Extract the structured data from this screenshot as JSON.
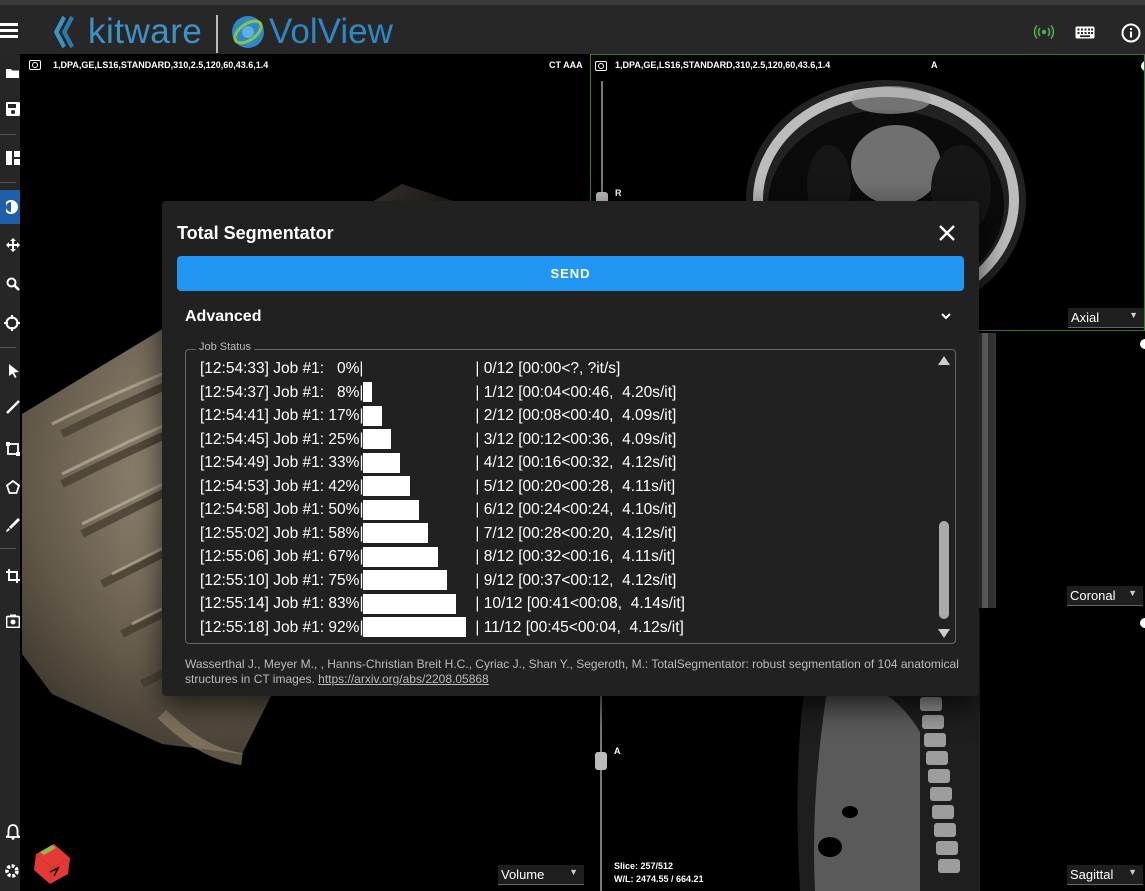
{
  "header": {
    "kitware_logo": "kitware",
    "volview_logo": "VolView",
    "icons": [
      "menu-icon",
      "server-connected-icon",
      "keyboard-icon",
      "info-icon"
    ],
    "accent_color": "#3c93c7",
    "connected_color": "#4caf50"
  },
  "sidebar": {
    "items": [
      "folder-open-icon",
      "save-icon",
      "layout-icon",
      "window-level-icon",
      "pan-icon",
      "zoom-icon",
      "crosshairs-icon",
      "select-icon",
      "ruler-icon",
      "rectangle-icon",
      "polygon-icon",
      "paint-icon",
      "crop-icon",
      "screenshot-icon",
      "notifications-icon",
      "settings-icon"
    ],
    "active_index": 3,
    "active_color": "#1f5fa8"
  },
  "views": {
    "volume": {
      "label": "1,DPA,GE,LS16,STANDARD,310,2.5,120,60,43.6,1.4",
      "series": "CT AAA",
      "type": "Volume"
    },
    "axial": {
      "label": "1,DPA,GE,LS16,STANDARD,310,2.5,120,60,43.6,1.4",
      "orientation": "A",
      "side_marker": "R",
      "type": "Axial"
    },
    "coronal": {
      "type": "Coronal"
    },
    "sagittal": {
      "type": "Sagittal",
      "orientation": "A",
      "slice": "Slice: 257/512",
      "wl": "W/L: 2474.55 / 664.21"
    }
  },
  "dialog": {
    "title": "Total Segmentator",
    "send_label": "SEND",
    "advanced_label": "Advanced",
    "job_status_label": "Job Status",
    "jobs": [
      {
        "time": "[12:54:33] Job #1:",
        "pct": "0%|",
        "fill": 0.0,
        "tail": "| 0/12 [00:00<?, ?it/s]"
      },
      {
        "time": "[12:54:37] Job #1:",
        "pct": "8%|",
        "fill": 0.08,
        "tail": "| 1/12 [00:04<00:46,  4.20s/it]"
      },
      {
        "time": "[12:54:41] Job #1:",
        "pct": "17%|",
        "fill": 0.17,
        "tail": "| 2/12 [00:08<00:40,  4.09s/it]"
      },
      {
        "time": "[12:54:45] Job #1:",
        "pct": "25%|",
        "fill": 0.25,
        "tail": "| 3/12 [00:12<00:36,  4.09s/it]"
      },
      {
        "time": "[12:54:49] Job #1:",
        "pct": "33%|",
        "fill": 0.33,
        "tail": "| 4/12 [00:16<00:32,  4.12s/it]"
      },
      {
        "time": "[12:54:53] Job #1:",
        "pct": "42%|",
        "fill": 0.42,
        "tail": "| 5/12 [00:20<00:28,  4.11s/it]"
      },
      {
        "time": "[12:54:58] Job #1:",
        "pct": "50%|",
        "fill": 0.5,
        "tail": "| 6/12 [00:24<00:24,  4.10s/it]"
      },
      {
        "time": "[12:55:02] Job #1:",
        "pct": "58%|",
        "fill": 0.58,
        "tail": "| 7/12 [00:28<00:20,  4.12s/it]"
      },
      {
        "time": "[12:55:06] Job #1:",
        "pct": "67%|",
        "fill": 0.67,
        "tail": "| 8/12 [00:32<00:16,  4.11s/it]"
      },
      {
        "time": "[12:55:10] Job #1:",
        "pct": "75%|",
        "fill": 0.75,
        "tail": "| 9/12 [00:37<00:12,  4.12s/it]"
      },
      {
        "time": "[12:55:14] Job #1:",
        "pct": "83%|",
        "fill": 0.83,
        "tail": "| 10/12 [00:41<00:08,  4.14s/it]"
      },
      {
        "time": "[12:55:18] Job #1:",
        "pct": "92%|",
        "fill": 0.92,
        "tail": "| 11/12 [00:45<00:04,  4.12s/it]"
      }
    ],
    "citation_text": "Wasserthal J., Meyer M., , Hanns-Christian Breit H.C., Cyriac J., Shan Y., Segeroth, M.: TotalSegmentator: robust segmentation of 104 anatomical structures in CT images. ",
    "citation_link": "https://arxiv.org/abs/2208.05868",
    "send_color": "#2196f3"
  }
}
